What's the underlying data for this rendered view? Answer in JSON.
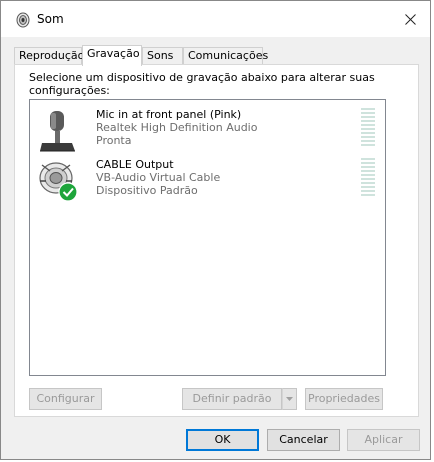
{
  "window": {
    "title": "Som"
  },
  "tabs": [
    {
      "label": "Reprodução",
      "active": false
    },
    {
      "label": "Gravação",
      "active": true
    },
    {
      "label": "Sons",
      "active": false
    },
    {
      "label": "Comunicações",
      "active": false
    }
  ],
  "panel": {
    "instruction": "Selecione um dispositivo de gravação abaixo para alterar suas configurações:"
  },
  "devices": [
    {
      "name": "Mic in at front panel (Pink)",
      "driver": "Realtek High Definition Audio",
      "status": "Pronta",
      "icon": "microphone-icon",
      "default": false
    },
    {
      "name": "CABLE Output",
      "driver": "VB-Audio Virtual Cable",
      "status": "Dispositivo Padrão",
      "icon": "cable-device-icon",
      "default": true
    }
  ],
  "buttons": {
    "configure": "Configurar",
    "set_default": "Definir padrão",
    "properties": "Propriedades",
    "ok": "OK",
    "cancel": "Cancelar",
    "apply": "Aplicar"
  },
  "colors": {
    "accent": "#0078d7",
    "check_green": "#1ea53b",
    "meter": "#cfe3dd"
  }
}
